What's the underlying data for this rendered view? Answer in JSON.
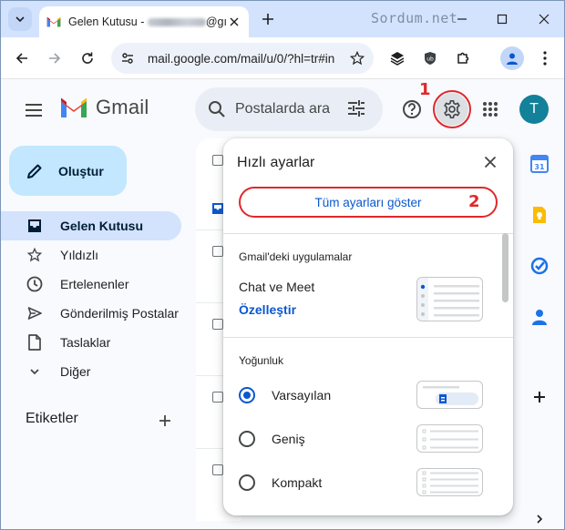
{
  "browser": {
    "tab_title_prefix": "Gelen Kutusu - ",
    "tab_title_suffix": "@gı",
    "watermark": "Sordum.net",
    "url": "mail.google.com/mail/u/0/?hl=tr#in"
  },
  "gmail": {
    "logo_text": "Gmail",
    "search_placeholder": "Postalarda ara",
    "avatar_letter": "T",
    "compose_label": "Oluştur",
    "nav": [
      {
        "label": "Gelen Kutusu",
        "icon": "inbox-icon",
        "active": true
      },
      {
        "label": "Yıldızlı",
        "icon": "star-icon",
        "active": false
      },
      {
        "label": "Ertelenenler",
        "icon": "clock-icon",
        "active": false
      },
      {
        "label": "Gönderilmiş Postalar",
        "icon": "send-icon",
        "active": false
      },
      {
        "label": "Taslaklar",
        "icon": "draft-icon",
        "active": false
      },
      {
        "label": "Diğer",
        "icon": "chevron-down-icon",
        "active": false
      }
    ],
    "labels_heading": "Etiketler"
  },
  "quick_settings": {
    "title": "Hızlı ayarlar",
    "all_settings_label": "Tüm ayarları göster",
    "apps_section": "Gmail'deki uygulamalar",
    "apps_item": "Chat ve Meet",
    "customize_label": "Özelleştir",
    "density_section": "Yoğunluk",
    "density_options": [
      {
        "label": "Varsayılan",
        "checked": true
      },
      {
        "label": "Geniş",
        "checked": false
      },
      {
        "label": "Kompakt",
        "checked": false
      }
    ]
  },
  "annotations": {
    "first": "1",
    "second": "2"
  },
  "colors": {
    "annotation_red": "#e0282a",
    "link_blue": "#0b57d0",
    "active_nav": "#d3e3fd",
    "compose_bg": "#c2e7ff",
    "avatar_bg": "#128199"
  }
}
